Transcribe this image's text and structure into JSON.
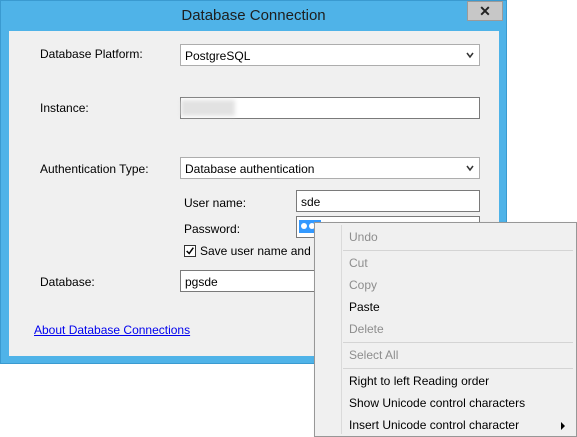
{
  "window": {
    "title": "Database Connection",
    "close_glyph": "✕"
  },
  "form": {
    "platform_label": "Database Platform:",
    "platform_value": "PostgreSQL",
    "instance_label": "Instance:",
    "instance_value": "",
    "auth_label": "Authentication Type:",
    "auth_value": "Database authentication",
    "username_label": "User name:",
    "username_value": "sde",
    "password_label": "Password:",
    "save_label": "Save user name and pas",
    "save_checked": true,
    "database_label": "Database:",
    "database_value": "pgsde",
    "about_link": "About Database Connections"
  },
  "context_menu": {
    "items": [
      {
        "label": "Undo",
        "enabled": false
      },
      {
        "label": "Cut",
        "enabled": false
      },
      {
        "label": "Copy",
        "enabled": false
      },
      {
        "label": "Paste",
        "enabled": true
      },
      {
        "label": "Delete",
        "enabled": false
      },
      {
        "label": "Select All",
        "enabled": false
      },
      {
        "label": "Right to left Reading order",
        "enabled": true
      },
      {
        "label": "Show Unicode control characters",
        "enabled": true
      },
      {
        "label": "Insert Unicode control character",
        "enabled": true,
        "submenu": true
      }
    ]
  },
  "colors": {
    "title_bar": "#4fb3e8",
    "selection": "#3399ff",
    "link": "#0000ee"
  }
}
